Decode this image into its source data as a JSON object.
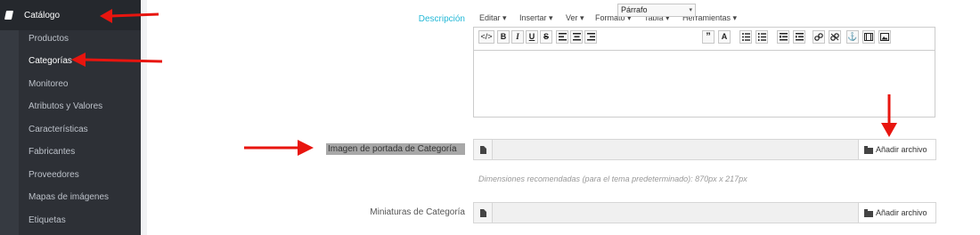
{
  "sidebar": {
    "section_label": "Catálogo",
    "section_icon": "book-icon",
    "items": [
      {
        "label": "Productos",
        "active": false
      },
      {
        "label": "Categorías",
        "active": true
      },
      {
        "label": "Monitoreo",
        "active": false
      },
      {
        "label": "Atributos y Valores",
        "active": false
      },
      {
        "label": "Características",
        "active": false
      },
      {
        "label": "Fabricantes",
        "active": false
      },
      {
        "label": "Proveedores",
        "active": false
      },
      {
        "label": "Mapas de imágenes",
        "active": false
      },
      {
        "label": "Etiquetas",
        "active": false
      }
    ]
  },
  "form": {
    "description_label": "Descripción",
    "editor": {
      "menu": [
        "Editar",
        "Insertar",
        "Ver",
        "Formato",
        "Tabla",
        "Herramientas"
      ],
      "format_select": "Párrafo",
      "tools": [
        "code-icon",
        "bold-icon",
        "italic-icon",
        "underline-icon",
        "strikethrough-icon",
        "align-left-icon",
        "align-center-icon",
        "align-right-icon",
        "blockquote-icon",
        "text-color-icon",
        "bullet-list-icon",
        "numbered-list-icon",
        "outdent-icon",
        "indent-icon",
        "link-icon",
        "unlink-icon",
        "anchor-icon",
        "media-icon",
        "image-icon"
      ],
      "content": ""
    },
    "cover_label": "Imagen de portada de Categoría",
    "cover_button": "Añadir archivo",
    "cover_hint": "Dimensiones recomendadas (para el tema predeterminado): 870px x 217px",
    "thumb_label": "Miniaturas de Categoría",
    "thumb_button": "Añadir archivo"
  },
  "colors": {
    "sidebar_bg": "#363a41",
    "sidebar_submenu_bg": "#2d3036",
    "label_accent": "#25b9d7",
    "annotation_arrow": "#e8150f",
    "highlight": "#a8a8a8"
  }
}
